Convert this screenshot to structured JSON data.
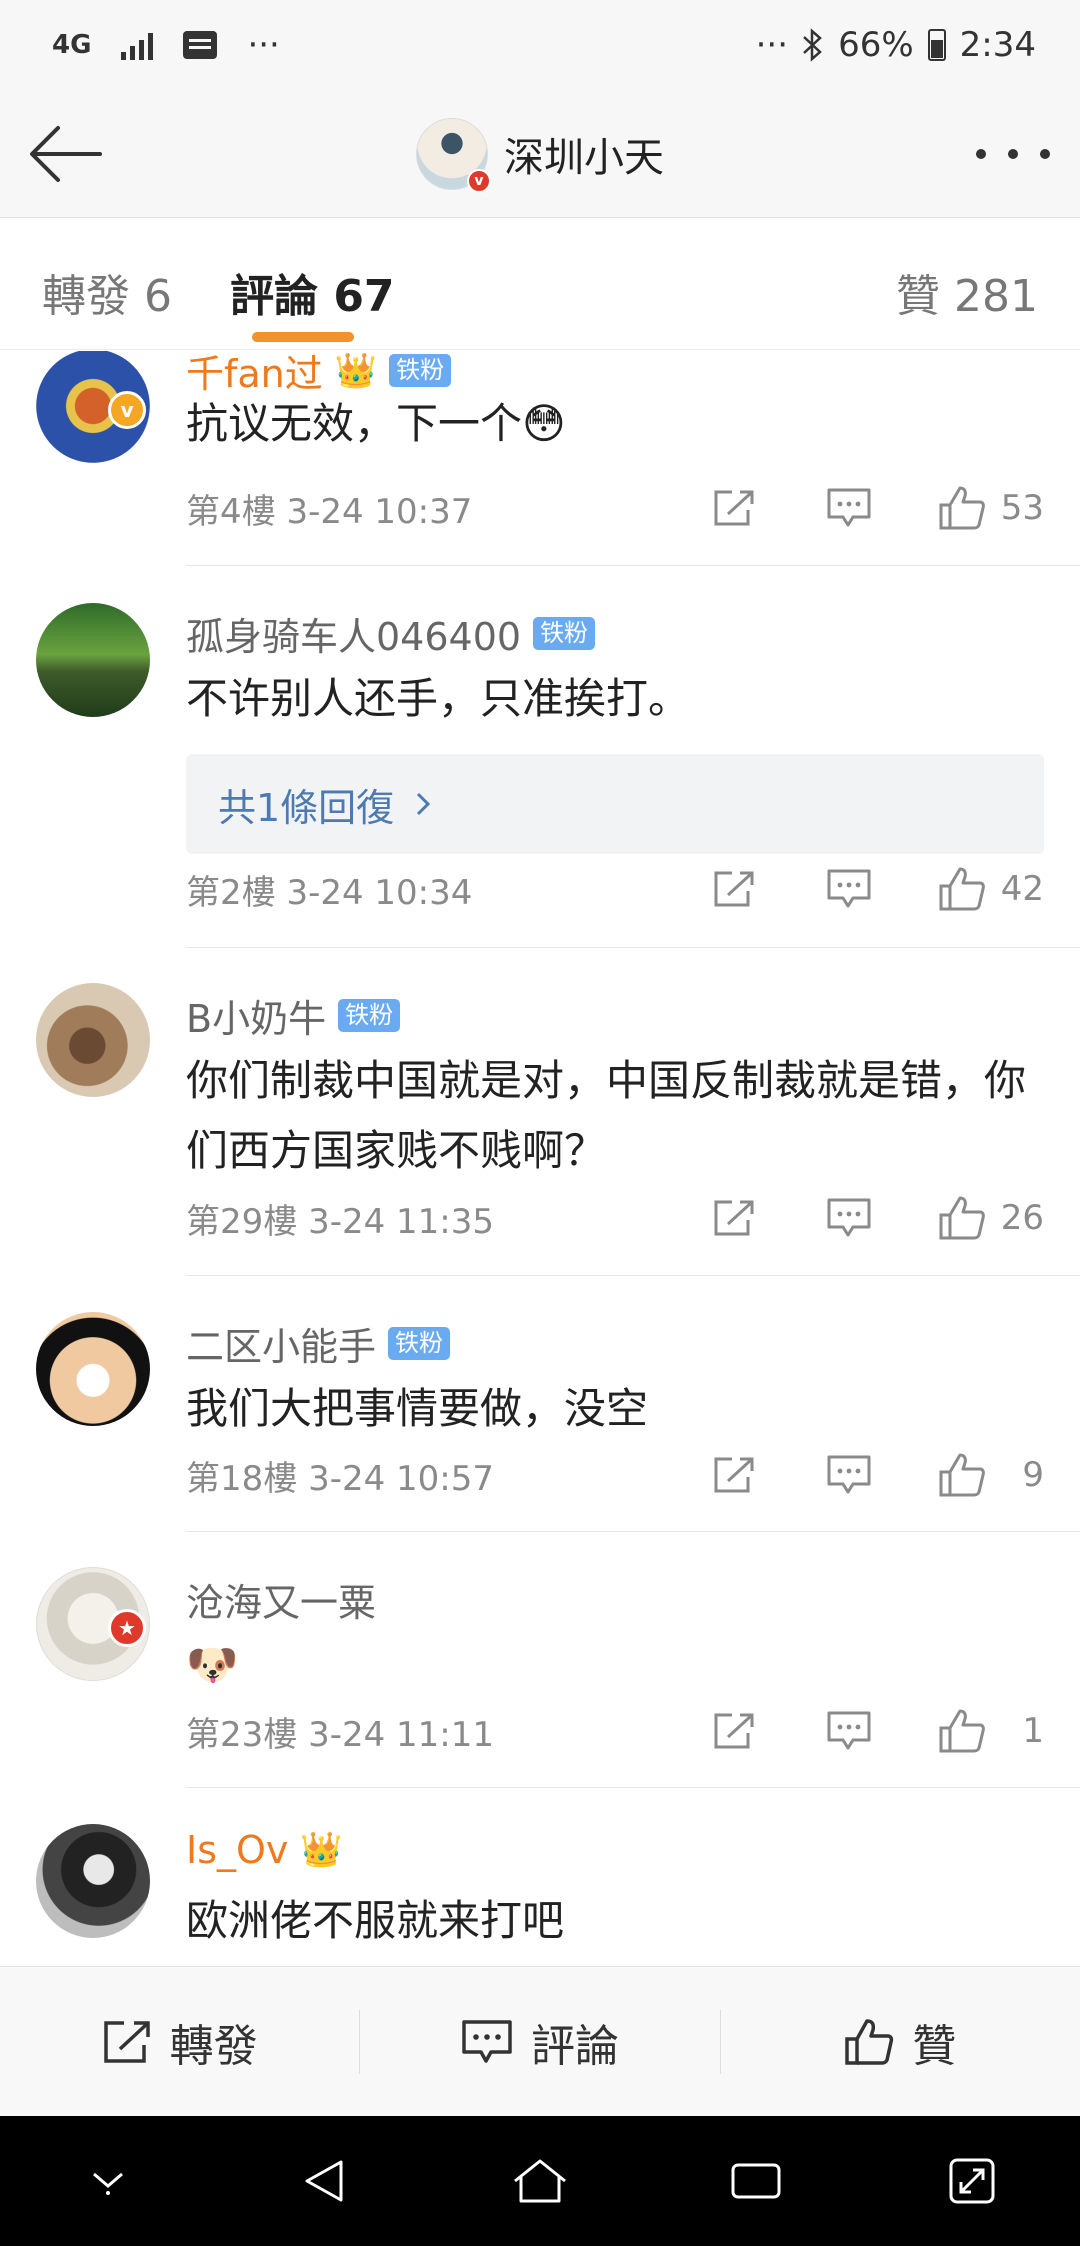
{
  "status_bar": {
    "network": "4G",
    "left_dots": "···",
    "right_dots": "···",
    "battery": "66%",
    "time": "2:34"
  },
  "header": {
    "username": "深圳小天"
  },
  "tabs": {
    "repost": "轉發 6",
    "comments": "評論 67",
    "likes": "贊 281"
  },
  "comments": [
    {
      "name": "千fan过",
      "fan_badge": "铁粉",
      "text": "抗议无效，下一个😳",
      "floor_time": "第4樓 3-24 10:37",
      "likes": "53"
    },
    {
      "name": "孤身骑车人046400",
      "fan_badge": "铁粉",
      "text": "不许别人还手，只准挨打。",
      "reply_link": "共1條回復",
      "floor_time": "第2樓 3-24 10:34",
      "likes": "42"
    },
    {
      "name": "B小奶牛",
      "fan_badge": "铁粉",
      "text": "你们制裁中国就是对，中国反制裁就是错，你们西方国家贱不贱啊？",
      "floor_time": "第29樓 3-24 11:35",
      "likes": "26"
    },
    {
      "name": "二区小能手",
      "fan_badge": "铁粉",
      "text": "我们大把事情要做，没空",
      "floor_time": "第18樓 3-24 10:57",
      "likes": "9"
    },
    {
      "name": "沧海又一粟",
      "text": "🐶",
      "floor_time": "第23樓 3-24 11:11",
      "likes": "1"
    },
    {
      "name": "Is_Ov",
      "text": "欧洲佬不服就来打吧"
    }
  ],
  "bottom_bar": {
    "repost": "轉發",
    "comment": "評論",
    "like": "贊"
  },
  "colors": {
    "accent": "#f3912a",
    "link": "#4d7ab1",
    "vip_name": "#ef7a1d",
    "fan_badge": "#6aaaf0"
  }
}
